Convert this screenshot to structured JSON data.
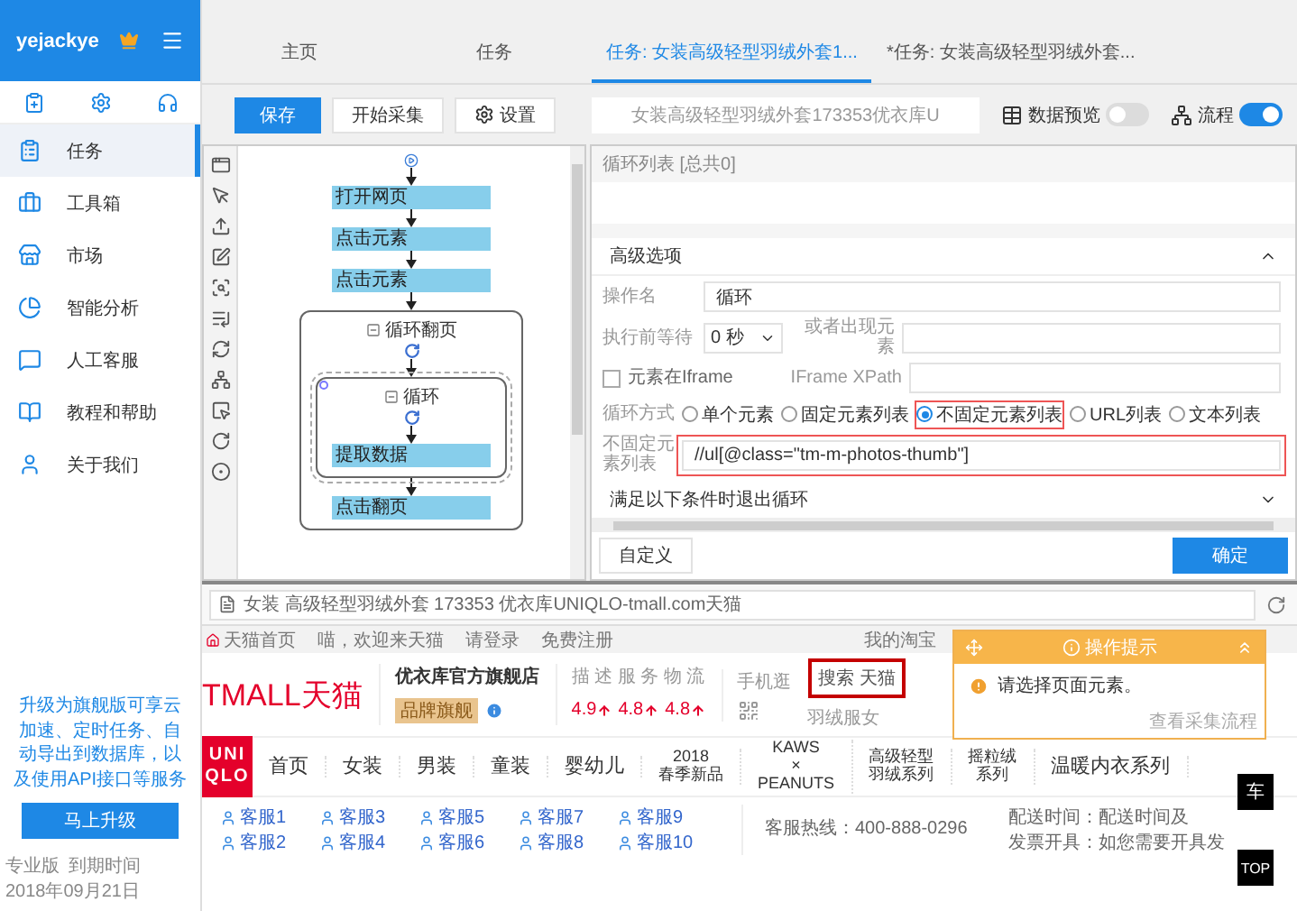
{
  "sidebar": {
    "user": "yejackye",
    "nav": [
      {
        "label": "任务",
        "selected": true
      },
      {
        "label": "工具箱",
        "selected": false
      },
      {
        "label": "市场",
        "selected": false
      },
      {
        "label": "智能分析",
        "selected": false
      },
      {
        "label": "人工客服",
        "selected": false
      },
      {
        "label": "教程和帮助",
        "selected": false
      },
      {
        "label": "关于我们",
        "selected": false
      }
    ],
    "promo": "升级为旗舰版可享云加速、定时任务、自动导出到数据库，以及使用API接口等服务",
    "upgrade_button": "马上升级",
    "edition": "专业版",
    "expiry_label": "到期时间",
    "expiry_date": "2018年09月21日"
  },
  "tabs": [
    {
      "label": "主页",
      "selected": false
    },
    {
      "label": "任务",
      "selected": false
    },
    {
      "label": "任务: 女装高级轻型羽绒外套1...",
      "selected": true
    },
    {
      "label": "*任务: 女装高级轻型羽绒外套...",
      "selected": false
    }
  ],
  "toolbar": {
    "save": "保存",
    "start": "开始采集",
    "settings": "设置",
    "url": "女装高级轻型羽绒外套173353优衣库U",
    "toggles": [
      {
        "kind": "table",
        "label": "数据预览",
        "on": false
      },
      {
        "kind": "flow",
        "label": "流程",
        "on": true
      }
    ]
  },
  "flow": {
    "nodes": [
      {
        "kind": "action",
        "label": "打开网页",
        "selected": false
      },
      {
        "kind": "action",
        "label": "点击元素",
        "selected": false
      },
      {
        "kind": "action",
        "label": "点击元素",
        "selected": false
      },
      {
        "kind": "loop",
        "label": "循环翻页",
        "selected": false,
        "children": [
          {
            "kind": "loop",
            "label": "循环",
            "selected": true,
            "children": [
              {
                "kind": "action",
                "label": "提取数据",
                "selected": false
              }
            ]
          },
          {
            "kind": "action",
            "label": "点击翻页",
            "selected": false
          }
        ]
      }
    ]
  },
  "settings": {
    "list_title": "循环列表 [总共0]",
    "advanced": {
      "title": "高级选项",
      "expanded": true
    },
    "action_name": {
      "label": "操作名",
      "value": "循环"
    },
    "wait": {
      "label": "执行前等待",
      "value": "0 秒"
    },
    "appear": {
      "label": "或者出现元素"
    },
    "iframe": {
      "label": "元素在Iframe",
      "checked": false
    },
    "iframe_xpath": {
      "label": "IFrame XPath"
    },
    "loop_mode": {
      "label": "循环方式",
      "options": [
        {
          "label": "单个元素",
          "selected": false
        },
        {
          "label": "固定元素列表",
          "selected": false
        },
        {
          "label": "不固定元素列表",
          "selected": true
        },
        {
          "label": "URL列表",
          "selected": false
        },
        {
          "label": "文本列表",
          "selected": false
        }
      ]
    },
    "xpath": {
      "label": "不固定元素列表",
      "value": "//ul[@class=\"tm-m-photos-thumb\"]"
    },
    "exit": {
      "title": "满足以下条件时退出循环",
      "expanded": false
    },
    "custom_button": "自定义",
    "ok_button": "确定"
  },
  "browser": {
    "address": "女装 高级轻型羽绒外套 173353 优衣库UNIQLO-tmall.com天猫",
    "top_links": [
      "天猫首页",
      "喵，欢迎来天猫",
      "请登录",
      "免费注册"
    ],
    "my_taobao": "我的淘宝",
    "logo": "TMALL天猫",
    "store_name": "优衣库官方旗舰店",
    "store_badge": "品牌旗舰",
    "ratings_label": "描 述 服 务 物 流",
    "ratings": [
      "4.9",
      "4.8",
      "4.8"
    ],
    "phone_label": "手机逛",
    "search": "搜索 天猫",
    "search_hint": "羽绒服女",
    "brand_lines": [
      "UNI",
      "QLO"
    ],
    "nav": [
      {
        "lines": [
          "首页"
        ]
      },
      {
        "lines": [
          "女装"
        ]
      },
      {
        "lines": [
          "男装"
        ]
      },
      {
        "lines": [
          "童装"
        ]
      },
      {
        "lines": [
          "婴幼儿"
        ]
      },
      {
        "lines": [
          "2018",
          "春季新品"
        ]
      },
      {
        "lines": [
          "KAWS",
          "×",
          "PEANUTS"
        ]
      },
      {
        "lines": [
          "高级轻型",
          "羽绒系列"
        ]
      },
      {
        "lines": [
          "摇粒绒",
          "系列"
        ]
      },
      {
        "lines": [
          "温暖内衣系列"
        ]
      }
    ],
    "service": [
      "客服1",
      "客服2",
      "客服3",
      "客服4",
      "客服5",
      "客服6",
      "客服7",
      "客服8",
      "客服9",
      "客服10"
    ],
    "hotline": "客服热线：400-888-0296",
    "delivery": "配送时间：配送时间及",
    "invoice": "发票开具：如您需要开具发",
    "cart": "车",
    "top": "TOP",
    "popup": {
      "title": "操作提示",
      "message": "请选择页面元素。",
      "link": "查看采集流程"
    }
  }
}
